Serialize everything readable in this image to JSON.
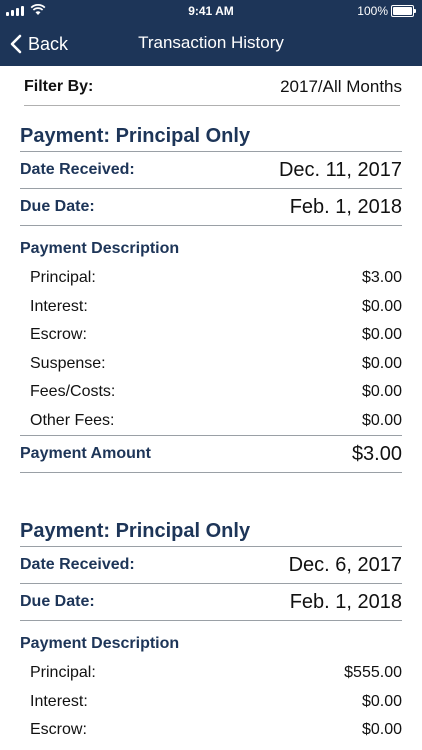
{
  "status_bar": {
    "time": "9:41 AM",
    "battery": "100%"
  },
  "nav": {
    "back_label": "Back",
    "title": "Transaction History"
  },
  "filter": {
    "label": "Filter By:",
    "value": "2017/All Months"
  },
  "transactions": [
    {
      "title": "Payment: Principal Only",
      "date_received_label": "Date Received:",
      "date_received": "Dec. 11, 2017",
      "due_date_label": "Due Date:",
      "due_date": "Feb. 1, 2018",
      "description_label": "Payment Description",
      "lines": [
        {
          "label": "Principal:",
          "value": "$3.00"
        },
        {
          "label": "Interest:",
          "value": "$0.00"
        },
        {
          "label": "Escrow:",
          "value": "$0.00"
        },
        {
          "label": "Suspense:",
          "value": "$0.00"
        },
        {
          "label": "Fees/Costs:",
          "value": "$0.00"
        },
        {
          "label": "Other Fees:",
          "value": "$0.00"
        }
      ],
      "amount_label": "Payment Amount",
      "amount": "$3.00"
    },
    {
      "title": "Payment: Principal Only",
      "date_received_label": "Date Received:",
      "date_received": "Dec. 6, 2017",
      "due_date_label": "Due Date:",
      "due_date": "Feb. 1, 2018",
      "description_label": "Payment Description",
      "lines": [
        {
          "label": "Principal:",
          "value": "$555.00"
        },
        {
          "label": "Interest:",
          "value": "$0.00"
        },
        {
          "label": "Escrow:",
          "value": "$0.00"
        }
      ]
    }
  ]
}
